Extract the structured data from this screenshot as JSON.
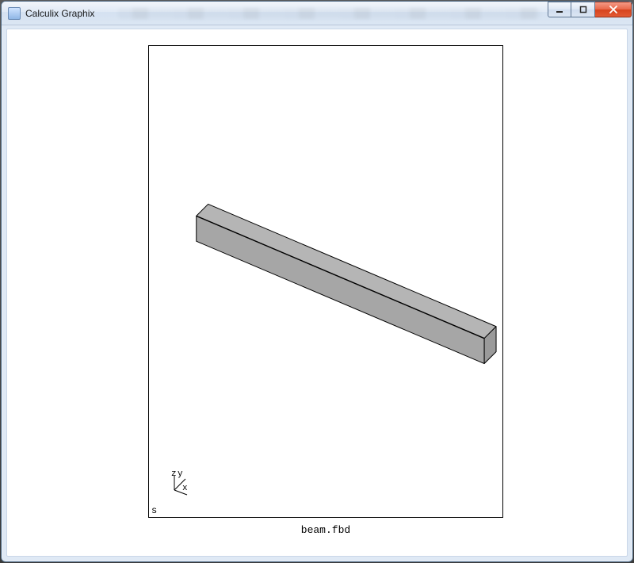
{
  "window": {
    "title": "Calculix Graphix",
    "controls": {
      "minimize_tooltip": "Minimize",
      "maximize_tooltip": "Maximize",
      "close_tooltip": "Close"
    }
  },
  "viewport": {
    "axis_labels": {
      "x": "x",
      "y": "y",
      "z": "z"
    },
    "status_char": "s",
    "model": {
      "name": "beam",
      "shape": "rectangular-prism",
      "faces": {
        "top_fill": "#b5b5b5",
        "front_fill": "#a6a6a6",
        "right_fill": "#9a9a9a",
        "edge": "#000000"
      }
    }
  },
  "footer": {
    "filename": "beam.fbd"
  }
}
